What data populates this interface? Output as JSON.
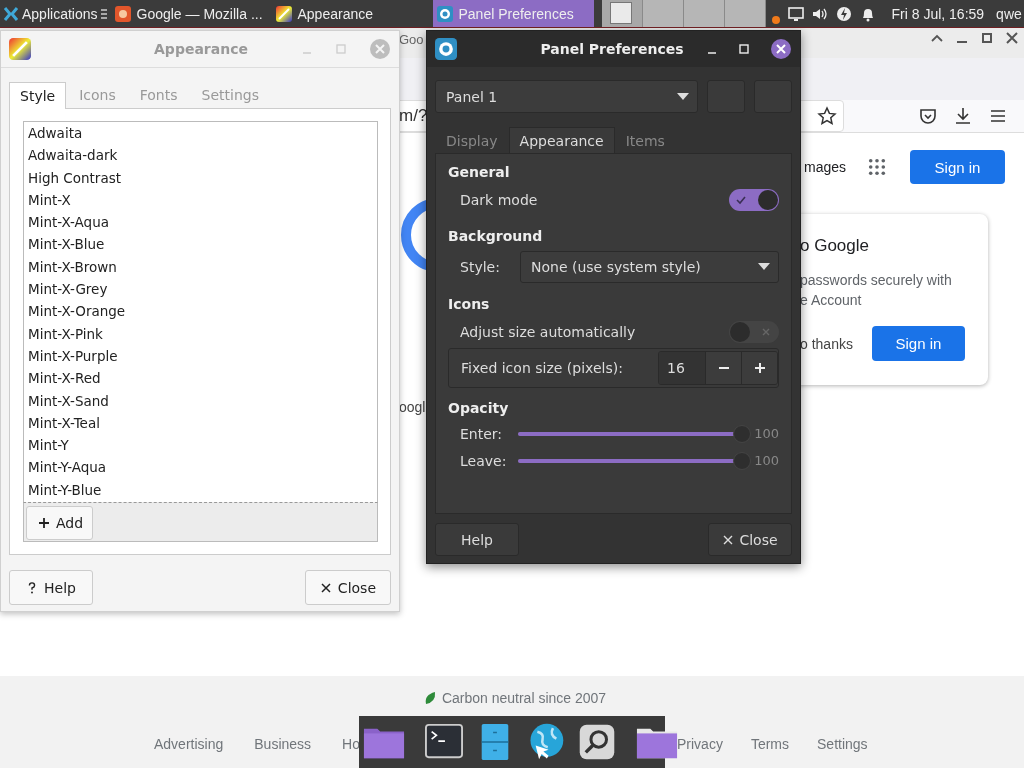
{
  "top_panel": {
    "apps_label": "Applications",
    "taskbar": [
      {
        "kind": "firefox",
        "label": "Google — Mozilla ...",
        "selected": false
      },
      {
        "kind": "appearance",
        "label": "Appearance",
        "selected": false
      },
      {
        "kind": "panel",
        "label": "Panel Preferences",
        "selected": true
      }
    ],
    "clock": "Fri  8 Jul, 16:59",
    "user": "qwe"
  },
  "browser": {
    "title_fragment": "Goo",
    "url_fragment": "m/?",
    "header_link": "mages",
    "sign_in": "Sign in",
    "page_fragment": "oogl",
    "popup": {
      "title": "o Google",
      "body": [
        "passwords securely with",
        "e Account"
      ],
      "dismiss": "o thanks",
      "sign_in": "Sign in"
    },
    "footer": {
      "carbon": "Carbon neutral since 2007",
      "links_left": [
        "Advertising",
        "Business",
        "Ho"
      ],
      "links_right": [
        "Privacy",
        "Terms",
        "Settings"
      ]
    }
  },
  "appearance_window": {
    "title": "Appearance",
    "tabs": [
      {
        "label": "Style",
        "selected": true
      },
      {
        "label": "Icons",
        "selected": false
      },
      {
        "label": "Fonts",
        "selected": false
      },
      {
        "label": "Settings",
        "selected": false
      }
    ],
    "themes": [
      "Adwaita",
      "Adwaita-dark",
      "High Contrast",
      "Mint-X",
      "Mint-X-Aqua",
      "Mint-X-Blue",
      "Mint-X-Brown",
      "Mint-X-Grey",
      "Mint-X-Orange",
      "Mint-X-Pink",
      "Mint-X-Purple",
      "Mint-X-Red",
      "Mint-X-Sand",
      "Mint-X-Teal",
      "Mint-Y",
      "Mint-Y-Aqua",
      "Mint-Y-Blue"
    ],
    "add": "Add",
    "help": "Help",
    "close": "Close"
  },
  "panel_window": {
    "title": "Panel Preferences",
    "panel_select": "Panel 1",
    "tabs": [
      {
        "label": "Display",
        "selected": false
      },
      {
        "label": "Appearance",
        "selected": true
      },
      {
        "label": "Items",
        "selected": false
      }
    ],
    "sections": [
      {
        "heading": "General",
        "rows": [
          {
            "kind": "switch",
            "label": "Dark mode",
            "on": true
          }
        ]
      },
      {
        "heading": "Background",
        "rows": [
          {
            "kind": "combo",
            "label": "Style:",
            "value": "None (use system style)"
          }
        ]
      },
      {
        "heading": "Icons",
        "rows": [
          {
            "kind": "switch",
            "label": "Adjust size automatically",
            "on": false
          },
          {
            "kind": "spin",
            "label": "Fixed icon size (pixels):",
            "value": "16"
          }
        ]
      },
      {
        "heading": "Opacity",
        "rows": [
          {
            "kind": "slider",
            "label": "Enter:",
            "level": 1,
            "reading": "100"
          },
          {
            "kind": "slider",
            "label": "Leave:",
            "level": 1,
            "reading": "100"
          }
        ]
      }
    ],
    "help": "Help",
    "close": "Close"
  }
}
